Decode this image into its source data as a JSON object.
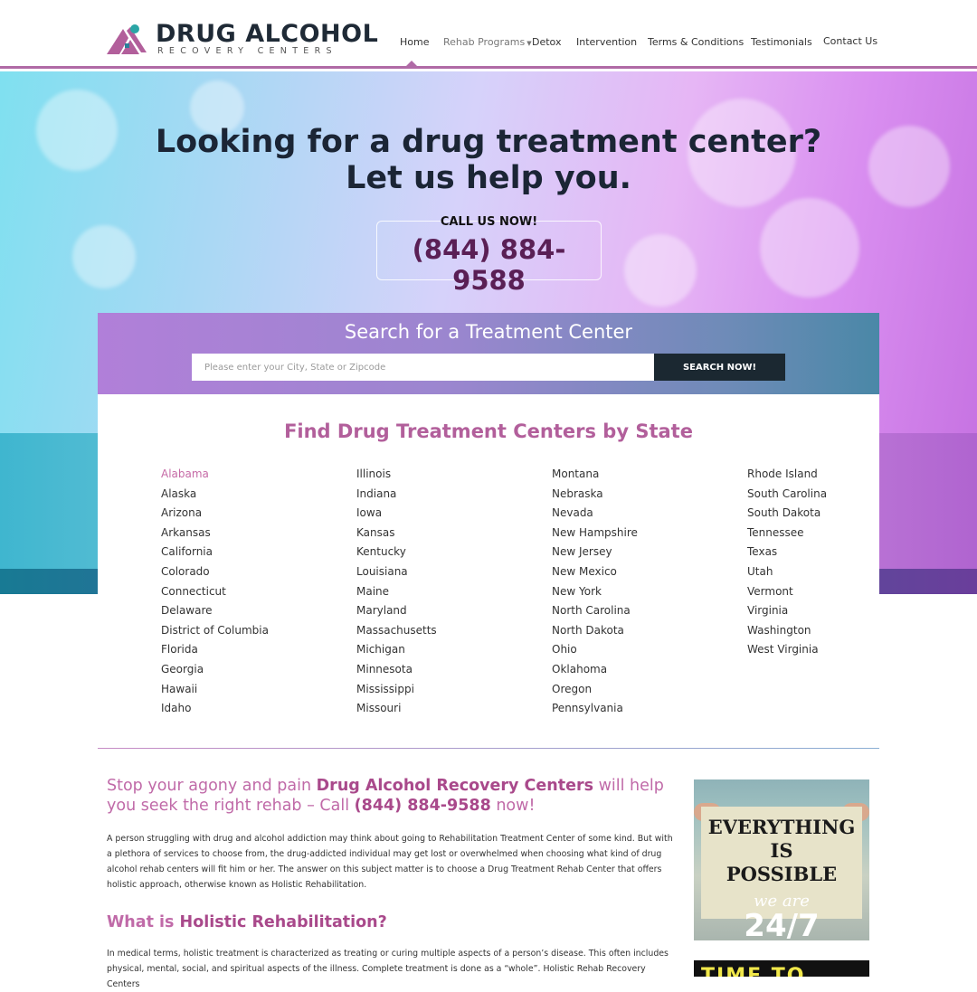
{
  "brand": {
    "title": "DRUG ALCOHOL",
    "subtitle": "RECOVERY CENTERS"
  },
  "nav": {
    "items": [
      {
        "label": "Home"
      },
      {
        "label": "Rehab Programs"
      },
      {
        "label": "Detox"
      },
      {
        "label": "Intervention"
      },
      {
        "label": "Terms & Conditions"
      },
      {
        "label": "Testimonials"
      },
      {
        "label": "Contact Us"
      }
    ],
    "active": "Home"
  },
  "hero": {
    "line1_prefix": "Looking for a ",
    "line1_bold": "drug treatment center?",
    "line2": "Let us help you.",
    "call_label": "CALL US NOW!",
    "phone": "(844) 884-9588"
  },
  "search": {
    "title": "Search for a Treatment Center",
    "placeholder": "Please enter your City, State or Zipcode",
    "button": "SEARCH NOW!"
  },
  "states": {
    "title": "Find Drug Treatment Centers by State",
    "active": "Alabama",
    "columns": [
      [
        "Alabama",
        "Alaska",
        "Arizona",
        "Arkansas",
        "California",
        "Colorado",
        "Connecticut",
        "Delaware",
        "District of Columbia",
        "Florida",
        "Georgia",
        "Hawaii",
        "Idaho"
      ],
      [
        "Illinois",
        "Indiana",
        "Iowa",
        "Kansas",
        "Kentucky",
        "Louisiana",
        "Maine",
        "Maryland",
        "Massachusetts",
        "Michigan",
        "Minnesota",
        "Mississippi",
        "Missouri"
      ],
      [
        "Montana",
        "Nebraska",
        "Nevada",
        "New Hampshire",
        "New Jersey",
        "New Mexico",
        "New York",
        "North Carolina",
        "North Dakota",
        "Ohio",
        "Oklahoma",
        "Oregon",
        "Pennsylvania"
      ],
      [
        "Rhode Island",
        "South Carolina",
        "South Dakota",
        "Tennessee",
        "Texas",
        "Utah",
        "Vermont",
        "Virginia",
        "Washington",
        "West Virginia"
      ]
    ]
  },
  "article": {
    "lead_prefix": "Stop your agony and pain ",
    "lead_brand": "Drug Alcohol Recovery Centers",
    "lead_middle": " will help you seek the right rehab – Call ",
    "lead_phone": "(844) 884-9588",
    "lead_suffix": " now!",
    "para1": "A person struggling with drug and alcohol addiction may think about going to Rehabilitation Treatment Center of some kind. But with a plethora of services to choose from, the drug-addicted individual may get lost or overwhelmed when choosing what kind of drug alcohol rehab centers will fit him or her. The answer on this subject matter is to choose a Drug Treatment Rehab Center that offers holistic approach, otherwise known as Holistic Rehabilitation.",
    "h2_prefix": "What is ",
    "h2_bold": "Holistic Rehabilitation?",
    "para2": "In medical terms, holistic treatment is characterized as treating or curing multiple aspects of a person’s disease. This often includes physical, mental, social, and spiritual aspects of the illness. Complete treatment is done as a “whole”. Holistic Rehab Recovery Centers"
  },
  "promo": {
    "line1": "EVERYTHING",
    "line2": "IS",
    "line3": "POSSIBLE",
    "sub": "we are",
    "big": "24/7",
    "second_text": "TIME TO"
  },
  "colors": {
    "accent": "#b25f9b",
    "accent_dark": "#a9498b",
    "header_border": "#b06aa6",
    "phone": "#5a1f55",
    "search_button": "#1b2831"
  }
}
